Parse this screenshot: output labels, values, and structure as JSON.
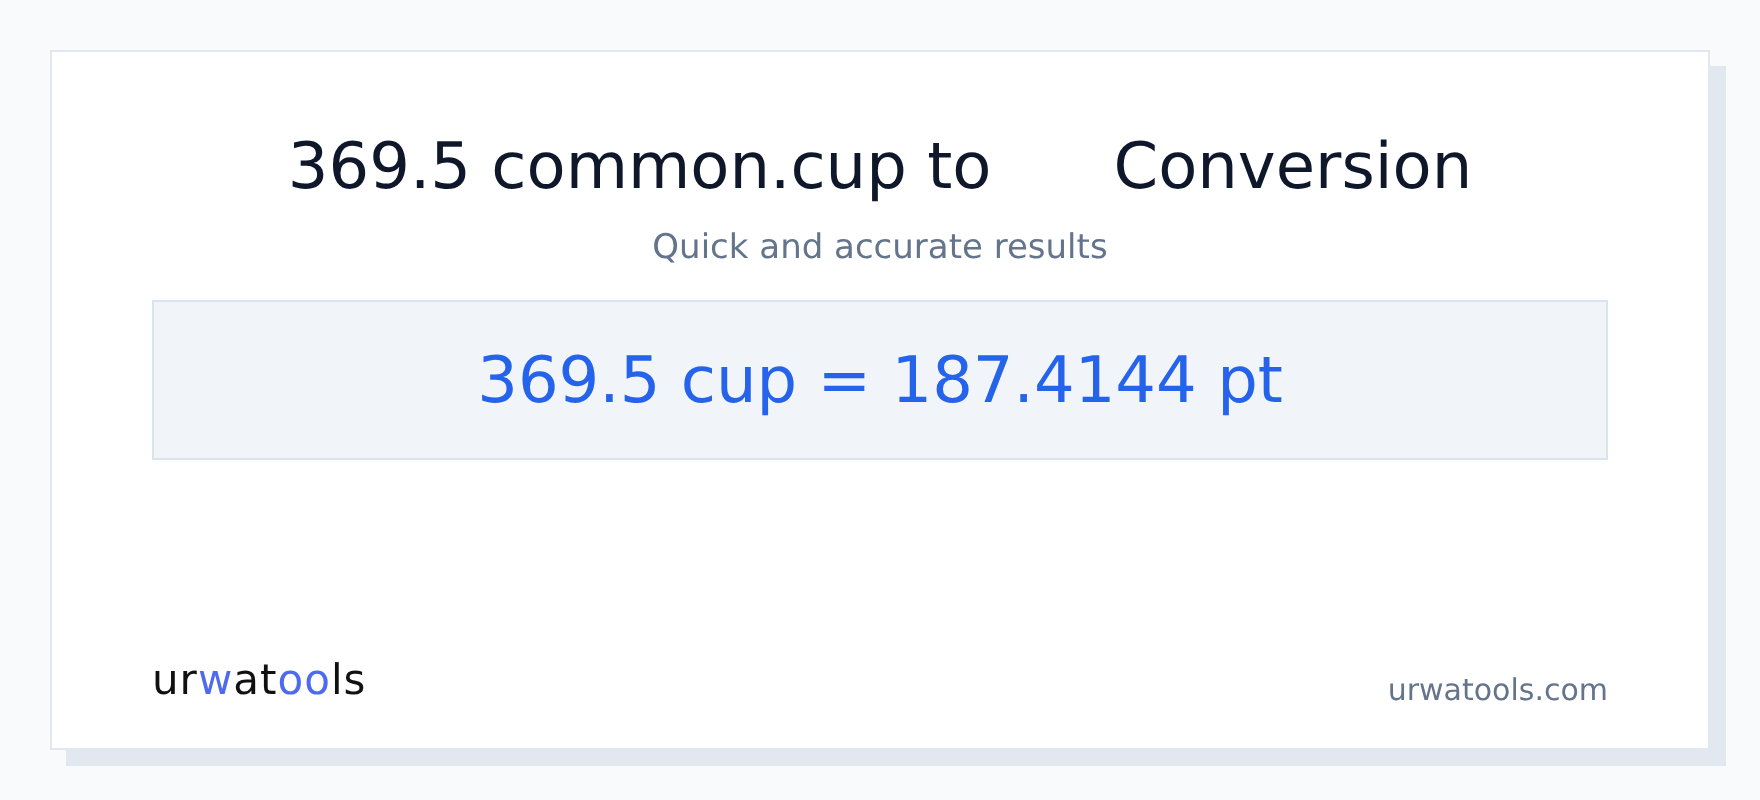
{
  "title": "369.5 common.cup to      Conversion",
  "subtitle": "Quick and accurate results",
  "result": "369.5 cup = 187.4144 pt",
  "logo": [
    {
      "text": "ur",
      "accent": false
    },
    {
      "text": "w",
      "accent": true
    },
    {
      "text": "at",
      "accent": false
    },
    {
      "text": "oo",
      "accent": true
    },
    {
      "text": "ls",
      "accent": false
    }
  ],
  "site": "urwatools.com"
}
